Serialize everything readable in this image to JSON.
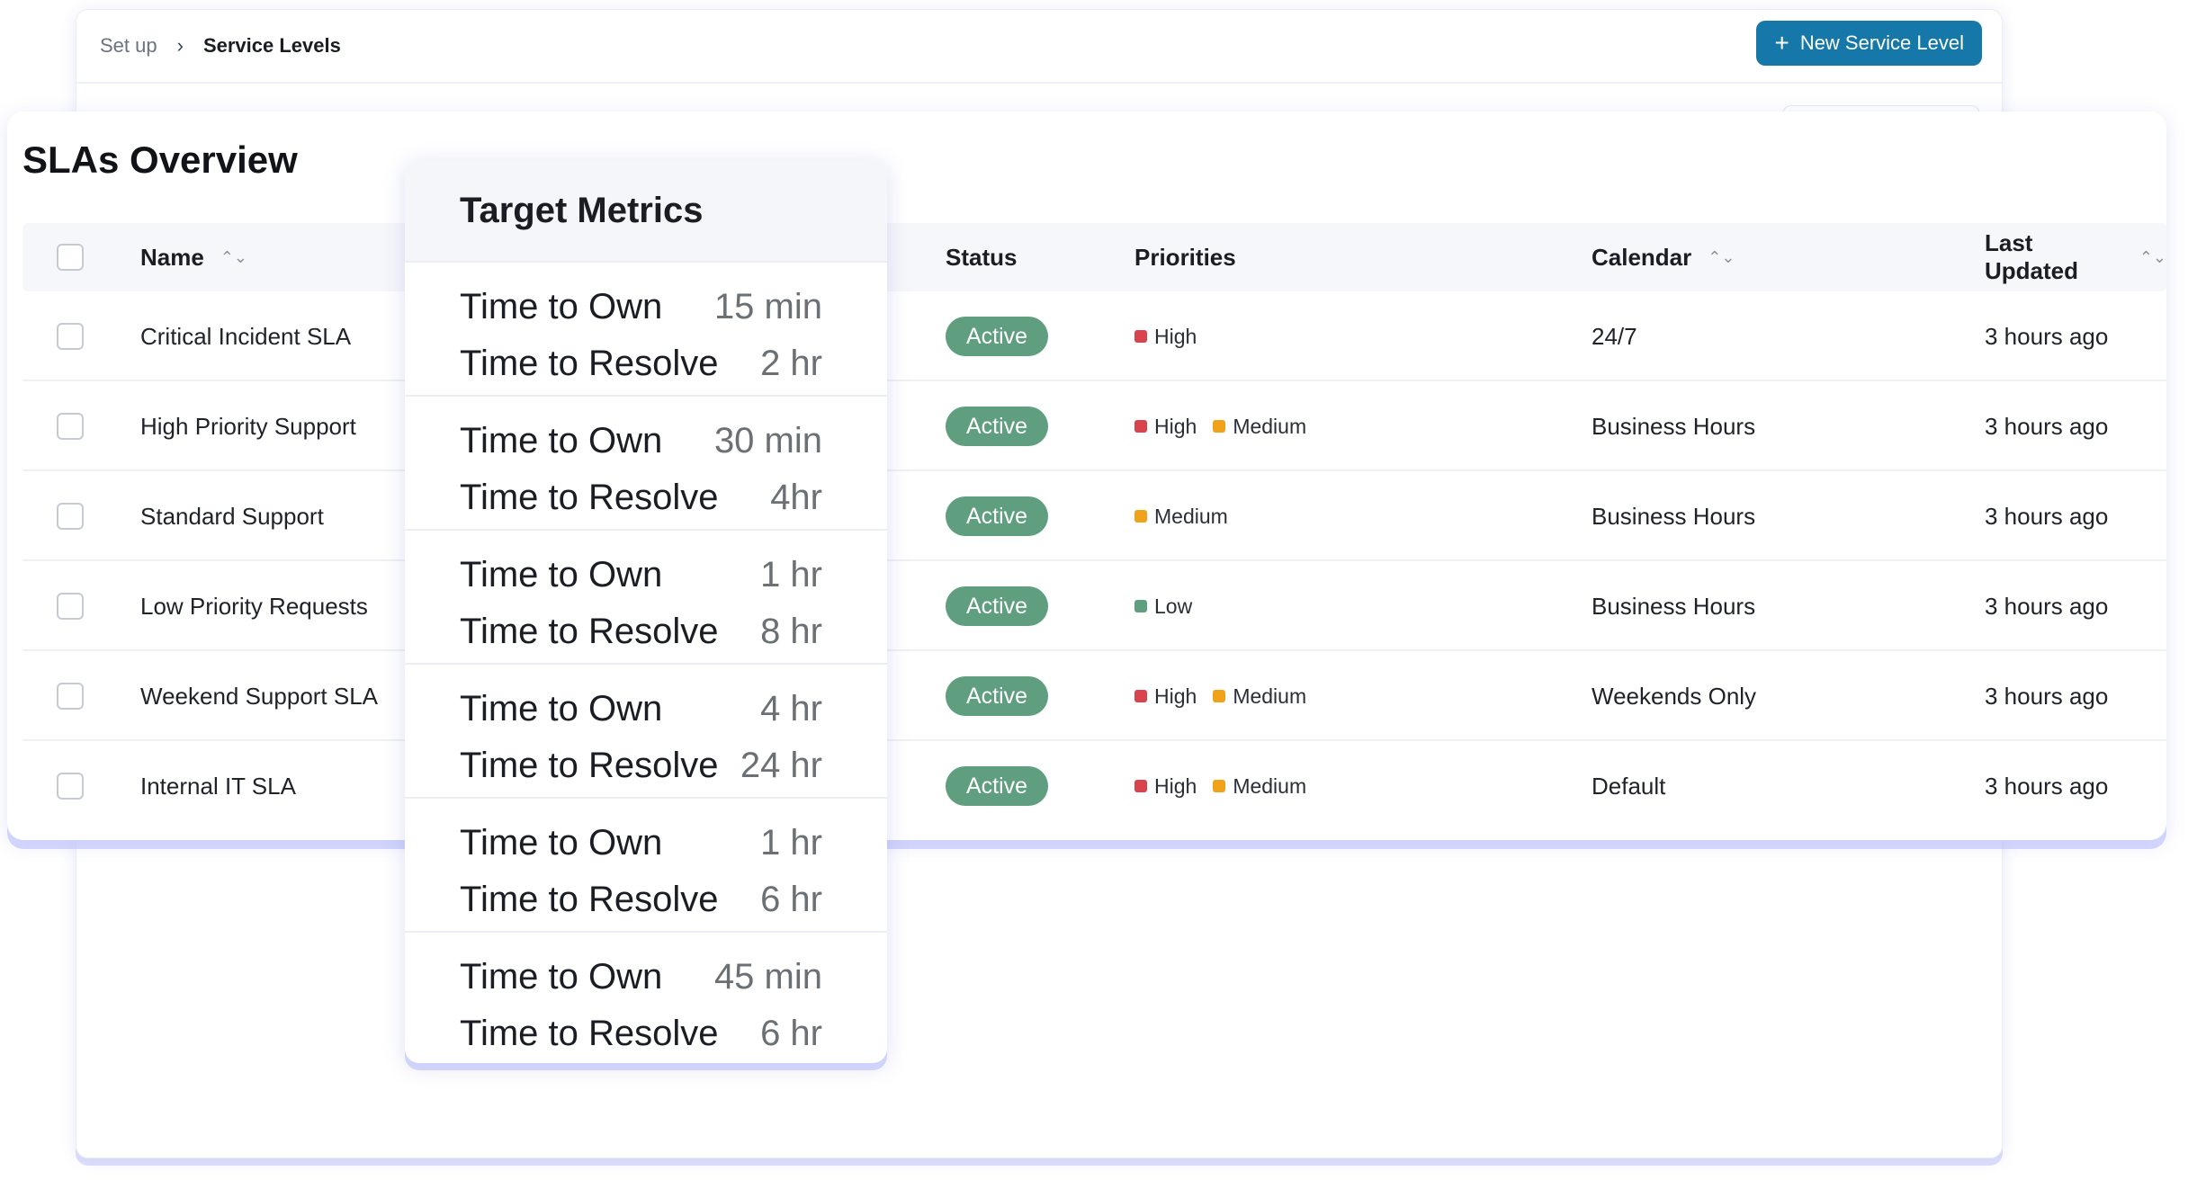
{
  "breadcrumb": {
    "root": "Set up",
    "separator": "›",
    "current": "Service Levels"
  },
  "actions": {
    "new_button_label": "New Service Level",
    "new_button_icon": "plus-icon"
  },
  "card": {
    "title": "SLAs Overview",
    "columns": {
      "name": "Name",
      "status": "Status",
      "priorities": "Priorities",
      "calendar": "Calendar",
      "last_updated": "Last Updated"
    },
    "rows": [
      {
        "name": "Critical Incident SLA",
        "status": "Active",
        "priorities": [
          {
            "label": "High",
            "color": "#d9434e"
          }
        ],
        "calendar": "24/7",
        "updated": "3 hours ago"
      },
      {
        "name": "High Priority Support",
        "status": "Active",
        "priorities": [
          {
            "label": "High",
            "color": "#d9434e"
          },
          {
            "label": "Medium",
            "color": "#f0a21b"
          }
        ],
        "calendar": "Business Hours",
        "updated": "3 hours ago"
      },
      {
        "name": "Standard Support",
        "status": "Active",
        "priorities": [
          {
            "label": "Medium",
            "color": "#f0a21b"
          }
        ],
        "calendar": "Business Hours",
        "updated": "3 hours ago"
      },
      {
        "name": "Low Priority Requests",
        "status": "Active",
        "priorities": [
          {
            "label": "Low",
            "color": "#5f9f80"
          }
        ],
        "calendar": "Business Hours",
        "updated": "3 hours ago"
      },
      {
        "name": "Weekend Support SLA",
        "status": "Active",
        "priorities": [
          {
            "label": "High",
            "color": "#d9434e"
          },
          {
            "label": "Medium",
            "color": "#f0a21b"
          }
        ],
        "calendar": "Weekends Only",
        "updated": "3 hours ago"
      },
      {
        "name": "Internal IT SLA",
        "status": "Active",
        "priorities": [
          {
            "label": "High",
            "color": "#d9434e"
          },
          {
            "label": "Medium",
            "color": "#f0a21b"
          }
        ],
        "calendar": "Default",
        "updated": "3 hours ago"
      }
    ]
  },
  "target_metrics": {
    "title": "Target Metrics",
    "own_label": "Time to Own",
    "resolve_label": "Time to Resolve",
    "items": [
      {
        "own": "15 min",
        "resolve": "2 hr"
      },
      {
        "own": "30 min",
        "resolve": "4hr"
      },
      {
        "own": "1 hr",
        "resolve": "8 hr"
      },
      {
        "own": "4 hr",
        "resolve": "24 hr"
      },
      {
        "own": "1 hr",
        "resolve": "6 hr"
      },
      {
        "own": "45 min",
        "resolve": "6 hr"
      }
    ]
  },
  "colors": {
    "primary": "#1678a8",
    "active_badge": "#5f9f80",
    "high": "#d9434e",
    "medium": "#f0a21b",
    "low": "#5f9f80"
  }
}
